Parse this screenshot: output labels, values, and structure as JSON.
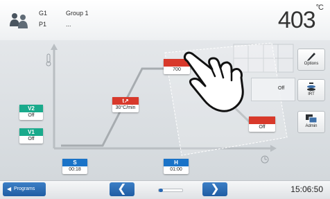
{
  "header": {
    "group_code": "G1",
    "group_name": "Group 1",
    "program_code": "P1",
    "program_name": "...",
    "temperature": "403",
    "temperature_unit": "°C"
  },
  "graph": {
    "v2": {
      "label": "V2",
      "value": "Off"
    },
    "v1": {
      "label": "V1",
      "value": "Off"
    },
    "s": {
      "label": "S",
      "value": "00:18"
    },
    "t_rate": {
      "label": "t↗",
      "value": "30°C/min"
    },
    "temp_box": {
      "label": "",
      "value": "700"
    },
    "cool_box": {
      "label": "",
      "value": "Off"
    },
    "h": {
      "label": "H",
      "value": "01:00"
    },
    "side_value": "Off"
  },
  "right_panel": {
    "options_label": "Options",
    "irt_label": "IRT",
    "admin_label": "Admin"
  },
  "footer": {
    "programs_label": "Programs",
    "time": "15:06:50"
  },
  "colors": {
    "teal": "#1aaa8c",
    "blue": "#1a73c8",
    "red": "#d8392b",
    "nav_blue": "#2667b3"
  }
}
